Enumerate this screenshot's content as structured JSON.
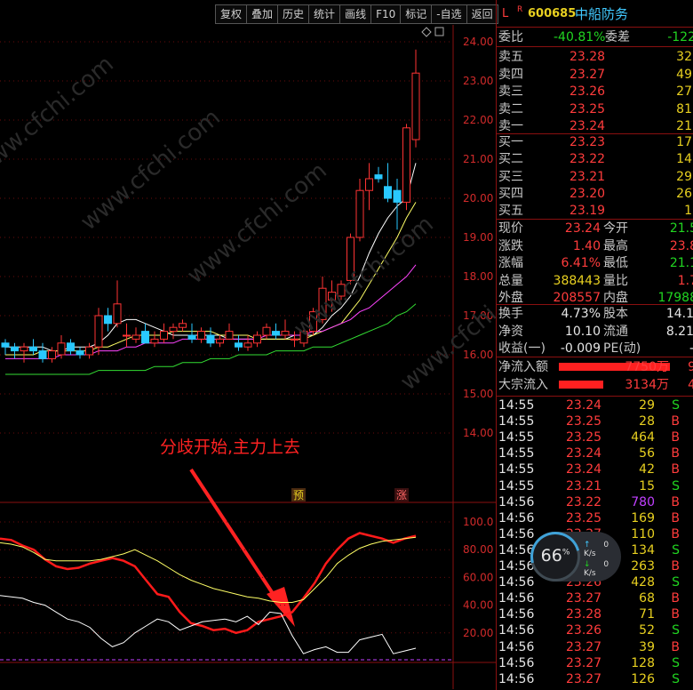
{
  "toolbar": [
    "复权",
    "叠加",
    "历史",
    "统计",
    "画线",
    "F10",
    "标记",
    "-自选",
    "返回"
  ],
  "header": {
    "flag_l": "L",
    "flag_r": "R",
    "code": "600685",
    "name": "中船防务"
  },
  "annotation": {
    "text": "分歧开始,主力上去",
    "marker_yu": "预",
    "marker_zhang": "涨"
  },
  "chart_data": [
    {
      "type": "candlestick",
      "title": "",
      "price_axis": {
        "ticks": [
          24.0,
          23.0,
          22.0,
          21.0,
          20.0,
          19.0,
          18.0,
          17.0,
          16.0,
          15.0,
          14.0
        ]
      },
      "candles": [
        [
          16.3,
          16.4,
          16.0,
          16.2
        ],
        [
          16.2,
          16.3,
          15.9,
          16.1
        ],
        [
          16.1,
          16.3,
          15.8,
          16.2
        ],
        [
          16.2,
          16.4,
          16.0,
          16.1
        ],
        [
          16.1,
          16.3,
          15.8,
          15.9
        ],
        [
          15.9,
          16.2,
          15.8,
          16.1
        ],
        [
          16.0,
          16.5,
          15.9,
          16.3
        ],
        [
          16.3,
          16.4,
          16.0,
          16.1
        ],
        [
          16.1,
          16.2,
          15.9,
          16.0
        ],
        [
          16.0,
          16.3,
          15.9,
          16.2
        ],
        [
          16.2,
          17.2,
          16.0,
          17.0
        ],
        [
          17.0,
          17.2,
          16.6,
          16.8
        ],
        [
          16.8,
          17.9,
          16.7,
          17.3
        ],
        [
          16.5,
          16.8,
          16.2,
          16.5
        ],
        [
          16.4,
          16.7,
          16.3,
          16.5
        ],
        [
          16.6,
          16.8,
          16.4,
          16.3
        ],
        [
          16.3,
          16.6,
          16.2,
          16.4
        ],
        [
          16.4,
          16.8,
          16.3,
          16.6
        ],
        [
          16.6,
          16.8,
          16.4,
          16.7
        ],
        [
          16.7,
          16.9,
          16.6,
          16.8
        ],
        [
          16.5,
          16.8,
          16.3,
          16.4
        ],
        [
          16.4,
          16.7,
          16.3,
          16.6
        ],
        [
          16.5,
          16.7,
          16.2,
          16.3
        ],
        [
          16.3,
          16.5,
          16.2,
          16.4
        ],
        [
          16.4,
          16.8,
          16.4,
          16.6
        ],
        [
          16.3,
          16.5,
          16.1,
          16.2
        ],
        [
          16.2,
          16.5,
          16.1,
          16.3
        ],
        [
          16.3,
          16.6,
          16.2,
          16.5
        ],
        [
          16.5,
          16.8,
          16.4,
          16.7
        ],
        [
          16.6,
          16.8,
          16.4,
          16.5
        ],
        [
          16.5,
          16.9,
          16.4,
          16.6
        ],
        [
          16.4,
          16.6,
          16.2,
          16.4
        ],
        [
          16.3,
          16.7,
          16.2,
          16.6
        ],
        [
          16.6,
          17.2,
          16.5,
          17.1
        ],
        [
          16.9,
          18.0,
          16.8,
          17.7
        ],
        [
          17.4,
          17.9,
          17.1,
          17.6
        ],
        [
          17.5,
          17.9,
          17.4,
          17.8
        ],
        [
          17.9,
          19.1,
          17.8,
          19.0
        ],
        [
          19.0,
          20.5,
          18.9,
          20.2
        ],
        [
          20.2,
          20.9,
          19.7,
          20.5
        ],
        [
          20.6,
          20.8,
          20.4,
          20.5
        ],
        [
          20.3,
          20.9,
          19.9,
          20.0
        ],
        [
          20.2,
          20.5,
          19.2,
          19.9
        ],
        [
          19.9,
          21.9,
          19.7,
          21.8
        ],
        [
          21.5,
          23.8,
          21.3,
          23.2
        ]
      ],
      "ma": [
        {
          "color": "#ffffff",
          "values": [
            16.2,
            16.2,
            16.2,
            16.2,
            16.2,
            16.1,
            16.1,
            16.2,
            16.2,
            16.2,
            16.3,
            16.5,
            16.8,
            16.9,
            16.9,
            16.8,
            16.7,
            16.6,
            16.5,
            16.5,
            16.5,
            16.5,
            16.5,
            16.5,
            16.4,
            16.4,
            16.4,
            16.4,
            16.4,
            16.4,
            16.4,
            16.5,
            16.5,
            16.5,
            16.7,
            17.0,
            17.2,
            17.5,
            18.0,
            18.6,
            19.1,
            19.5,
            19.8,
            20.0,
            20.9
          ]
        },
        {
          "color": "#ffff66",
          "values": [
            16.0,
            16.0,
            16.0,
            16.0,
            16.1,
            16.1,
            16.1,
            16.1,
            16.1,
            16.1,
            16.2,
            16.2,
            16.3,
            16.4,
            16.5,
            16.5,
            16.5,
            16.5,
            16.6,
            16.6,
            16.6,
            16.6,
            16.6,
            16.5,
            16.5,
            16.5,
            16.5,
            16.4,
            16.4,
            16.4,
            16.4,
            16.4,
            16.4,
            16.5,
            16.6,
            16.7,
            16.8,
            17.1,
            17.4,
            17.8,
            18.2,
            18.6,
            19.0,
            19.5,
            19.9
          ]
        },
        {
          "color": "#ff44ff",
          "values": [
            15.9,
            15.9,
            15.9,
            15.9,
            15.9,
            15.9,
            16.0,
            16.0,
            16.0,
            16.0,
            16.1,
            16.1,
            16.1,
            16.2,
            16.2,
            16.3,
            16.3,
            16.3,
            16.3,
            16.4,
            16.4,
            16.4,
            16.4,
            16.4,
            16.4,
            16.4,
            16.4,
            16.4,
            16.5,
            16.5,
            16.5,
            16.5,
            16.5,
            16.6,
            16.6,
            16.7,
            16.8,
            16.9,
            17.1,
            17.2,
            17.4,
            17.6,
            17.8,
            18.0,
            18.3
          ]
        },
        {
          "color": "#33dd33",
          "values": [
            15.5,
            15.5,
            15.5,
            15.5,
            15.5,
            15.5,
            15.5,
            15.5,
            15.5,
            15.5,
            15.6,
            15.6,
            15.6,
            15.6,
            15.6,
            15.6,
            15.7,
            15.7,
            15.7,
            15.8,
            15.8,
            15.8,
            15.9,
            15.9,
            15.9,
            16.0,
            16.0,
            16.0,
            16.0,
            16.1,
            16.1,
            16.1,
            16.1,
            16.2,
            16.2,
            16.2,
            16.3,
            16.4,
            16.5,
            16.6,
            16.7,
            16.8,
            17.0,
            17.1,
            17.3
          ]
        }
      ]
    },
    {
      "type": "line",
      "title": "",
      "ylim": [
        0,
        110
      ],
      "yticks": [
        100.0,
        80.0,
        60.0,
        40.0,
        20.0
      ],
      "series": [
        {
          "color": "#ff1a1a",
          "values": [
            88,
            87,
            83,
            80,
            73,
            68,
            66,
            67,
            70,
            72,
            74,
            72,
            68,
            58,
            48,
            46,
            35,
            27,
            25,
            22,
            23,
            20,
            22,
            28,
            30,
            32,
            35,
            45,
            56,
            70,
            80,
            88,
            92,
            90,
            88,
            85,
            88,
            90
          ]
        },
        {
          "color": "#ffff66",
          "values": [
            85,
            84,
            82,
            78,
            73,
            72,
            72,
            72,
            72,
            73,
            75,
            77,
            80,
            76,
            72,
            67,
            62,
            58,
            55,
            52,
            50,
            48,
            46,
            45,
            43,
            42,
            42,
            44,
            52,
            60,
            70,
            76,
            81,
            84,
            86,
            87,
            88,
            89
          ]
        },
        {
          "color": "#ffffff",
          "values": [
            47,
            46,
            45,
            42,
            40,
            35,
            30,
            28,
            24,
            16,
            10,
            13,
            20,
            25,
            30,
            28,
            22,
            25,
            28,
            29,
            30,
            28,
            32,
            26,
            35,
            34,
            18,
            5,
            8,
            10,
            6,
            6,
            15,
            17,
            19,
            5,
            7,
            9
          ]
        }
      ]
    }
  ],
  "panel": {
    "weibi": {
      "label": "委比",
      "value": "-40.81%",
      "label2": "委差",
      "value2": "-122"
    },
    "sell": [
      {
        "label": "卖五",
        "price": "23.28",
        "vol": "32"
      },
      {
        "label": "卖四",
        "price": "23.27",
        "vol": "49"
      },
      {
        "label": "卖三",
        "price": "23.26",
        "vol": "27"
      },
      {
        "label": "卖二",
        "price": "23.25",
        "vol": "81"
      },
      {
        "label": "卖一",
        "price": "23.24",
        "vol": "21"
      }
    ],
    "buy": [
      {
        "label": "买一",
        "price": "23.23",
        "vol": "17"
      },
      {
        "label": "买二",
        "price": "23.22",
        "vol": "14"
      },
      {
        "label": "买三",
        "price": "23.21",
        "vol": "29"
      },
      {
        "label": "买四",
        "price": "23.20",
        "vol": "26"
      },
      {
        "label": "买五",
        "price": "23.19",
        "vol": "1"
      }
    ],
    "stats": [
      {
        "l1": "现价",
        "v1": "23.24",
        "c1": "red",
        "l2": "今开",
        "v2": "21.5",
        "c2": "green"
      },
      {
        "l1": "涨跌",
        "v1": "1.40",
        "c1": "red",
        "l2": "最高",
        "v2": "23.8",
        "c2": "red"
      },
      {
        "l1": "涨幅",
        "v1": "6.41%",
        "c1": "red",
        "l2": "最低",
        "v2": "21.1",
        "c2": "green"
      },
      {
        "l1": "总量",
        "v1": "388443",
        "c1": "yellow",
        "l2": "量比",
        "v2": "1.7",
        "c2": "red"
      },
      {
        "l1": "外盘",
        "v1": "208557",
        "c1": "red",
        "l2": "内盘",
        "v2": "17988",
        "c2": "green"
      }
    ],
    "stats2": [
      {
        "l1": "换手",
        "v1": "4.73%",
        "c1": "white",
        "l2": "股本",
        "v2": "14.1",
        "c2": "white"
      },
      {
        "l1": "净资",
        "v1": "10.10",
        "c1": "white",
        "l2": "流通",
        "v2": "8.21",
        "c2": "white"
      },
      {
        "l1": "收益(一)",
        "v1": "-0.009",
        "c1": "white",
        "l2": "PE(动)",
        "v2": "-",
        "c2": "white"
      }
    ],
    "flows": [
      {
        "label": "净流入额",
        "value": "7750万",
        "tail": "9",
        "bar": 125
      },
      {
        "label": "大宗流入",
        "value": "3134万",
        "tail": "4",
        "bar": 50
      }
    ],
    "ticks": [
      {
        "t": "14:55",
        "p": "23.24",
        "v": "29",
        "s": "S"
      },
      {
        "t": "14:55",
        "p": "23.25",
        "v": "28",
        "s": "B"
      },
      {
        "t": "14:55",
        "p": "23.25",
        "v": "464",
        "s": "B"
      },
      {
        "t": "14:55",
        "p": "23.24",
        "v": "56",
        "s": "B"
      },
      {
        "t": "14:55",
        "p": "23.24",
        "v": "42",
        "s": "B"
      },
      {
        "t": "14:55",
        "p": "23.21",
        "v": "15",
        "s": "S"
      },
      {
        "t": "14:56",
        "p": "23.22",
        "v": "780",
        "s": "B"
      },
      {
        "t": "14:56",
        "p": "23.25",
        "v": "169",
        "s": "B"
      },
      {
        "t": "14:56",
        "p": "23.27",
        "v": "110",
        "s": "B"
      },
      {
        "t": "14:56",
        "p": "23.26",
        "v": "134",
        "s": "S"
      },
      {
        "t": "14:56",
        "p": "23.26",
        "v": "263",
        "s": "B"
      },
      {
        "t": "14:56",
        "p": "23.26",
        "v": "428",
        "s": "S"
      },
      {
        "t": "14:56",
        "p": "23.27",
        "v": "68",
        "s": "B"
      },
      {
        "t": "14:56",
        "p": "23.28",
        "v": "71",
        "s": "B"
      },
      {
        "t": "14:56",
        "p": "23.26",
        "v": "52",
        "s": "S"
      },
      {
        "t": "14:56",
        "p": "23.27",
        "v": "39",
        "s": "B"
      },
      {
        "t": "14:56",
        "p": "23.27",
        "v": "128",
        "s": "S"
      },
      {
        "t": "14:56",
        "p": "23.27",
        "v": "126",
        "s": "S"
      }
    ]
  },
  "widget": {
    "percent": "66",
    "unit": "%",
    "up": "0",
    "down": "0",
    "speed_unit": "K/s"
  },
  "watermark": "www.cfchi.com"
}
